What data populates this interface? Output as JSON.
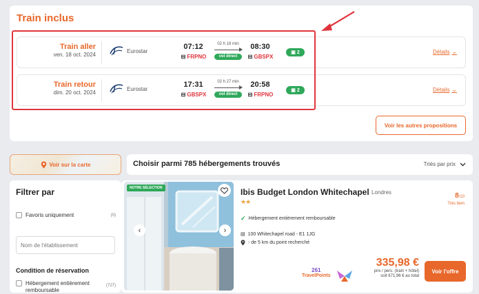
{
  "train_section": {
    "title": "Train inclus",
    "outbound": {
      "label": "Train aller",
      "date": "ven. 18 oct. 2024",
      "operator": "Eurostar",
      "depart_time": "07:12",
      "depart_station": "FRPNO",
      "duration": "02 h 18 min",
      "direct_label": "vol direct",
      "arrive_time": "08:30",
      "arrive_station": "GBSPX",
      "bags": "2",
      "details_label": "Détails"
    },
    "return": {
      "label": "Train retour",
      "date": "dim. 20 oct. 2024",
      "operator": "Eurostar",
      "depart_time": "17:31",
      "depart_station": "GBSPX",
      "duration": "02 h 27 min",
      "direct_label": "vol direct",
      "arrive_time": "20:58",
      "arrive_station": "FRPNO",
      "bags": "2",
      "details_label": "Détails"
    },
    "other_options_label": "Voir les autres propositions"
  },
  "map_button": {
    "label": "Voir sur la carte"
  },
  "filters": {
    "title": "Filtrer par",
    "favorites_label": "Favoris uniquement",
    "favorites_count": "(0)",
    "name_placeholder": "Nom de l'établissement",
    "condition_title": "Condition de réservation",
    "refundable_label": "Hébergement entièrement remboursable",
    "refundable_count": "(727)"
  },
  "results": {
    "title": "Choisir parmi 785 hébergements trouvés",
    "sort_label": "Triés par prix"
  },
  "hotel": {
    "badge": "NOTRE SÉLECTION",
    "name": "Ibis Budget London Whitechapel",
    "city": "Londres",
    "stars": "★★",
    "score": "8",
    "score_max": "/10",
    "score_label": "Très bien",
    "refundable": "Hébergement entièrement remboursable",
    "address": "100 Whitechapel road - E1 1JG",
    "distance": "- de 5 km du point recherché",
    "travelpoints_value": "261",
    "travelpoints_label": "TravelPoints",
    "price": "335,98 €",
    "price_per": "prix / pers. (train + hôtel)",
    "price_total": "soit 671,96 € au total",
    "offer_button": "Voir l'offre"
  },
  "colors": {
    "accent": "#e8672a",
    "green": "#2fa85a",
    "highlight": "#e0343c"
  }
}
